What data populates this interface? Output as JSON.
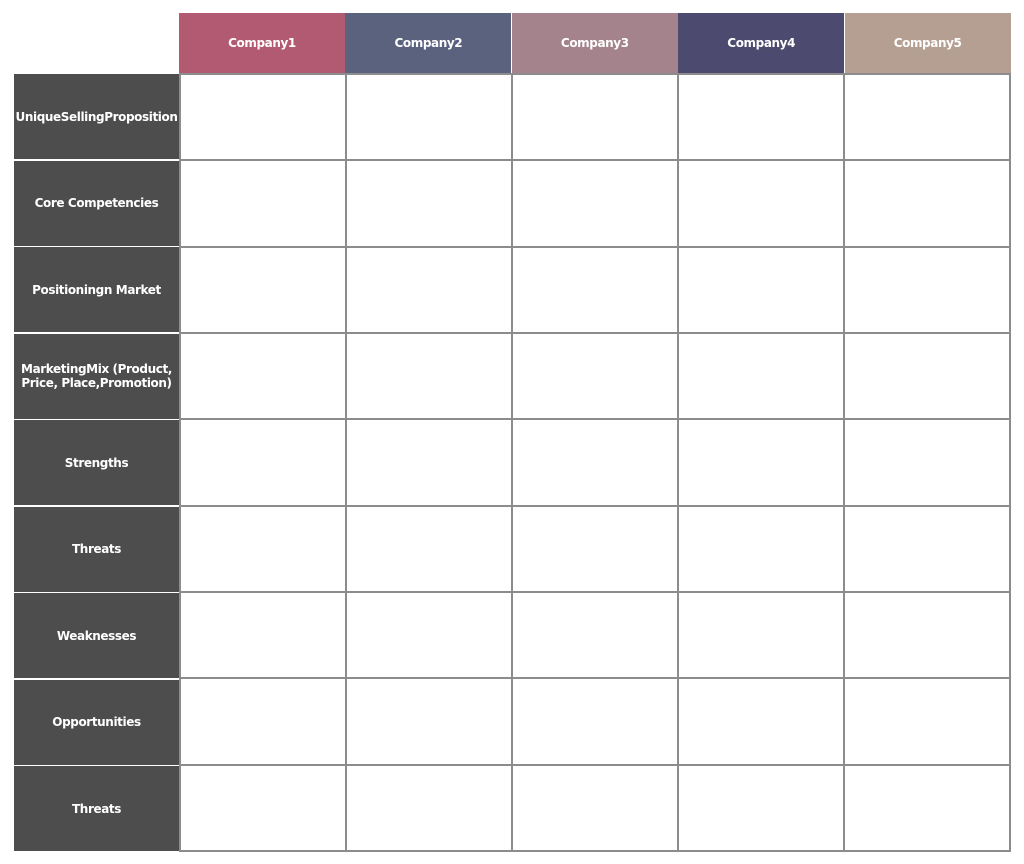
{
  "companies": [
    {
      "label": "Company1",
      "color": "#b15a72"
    },
    {
      "label": "Company2",
      "color": "#5a627e"
    },
    {
      "label": "Company3",
      "color": "#a5838c"
    },
    {
      "label": "Company4",
      "color": "#4d4a6f"
    },
    {
      "label": "Company5",
      "color": "#b59e92"
    }
  ],
  "rows": [
    {
      "label": "UniqueSellingProposition"
    },
    {
      "label": "Core Competencies"
    },
    {
      "label": "Positioningn Market"
    },
    {
      "label": "MarketingMix (Product, Price, Place,Promotion)"
    },
    {
      "label": "Strengths"
    },
    {
      "label": "Threats"
    },
    {
      "label": "Weaknesses"
    },
    {
      "label": "Opportunities"
    },
    {
      "label": "Threats"
    }
  ],
  "row_label_color": "#4d4d4d"
}
